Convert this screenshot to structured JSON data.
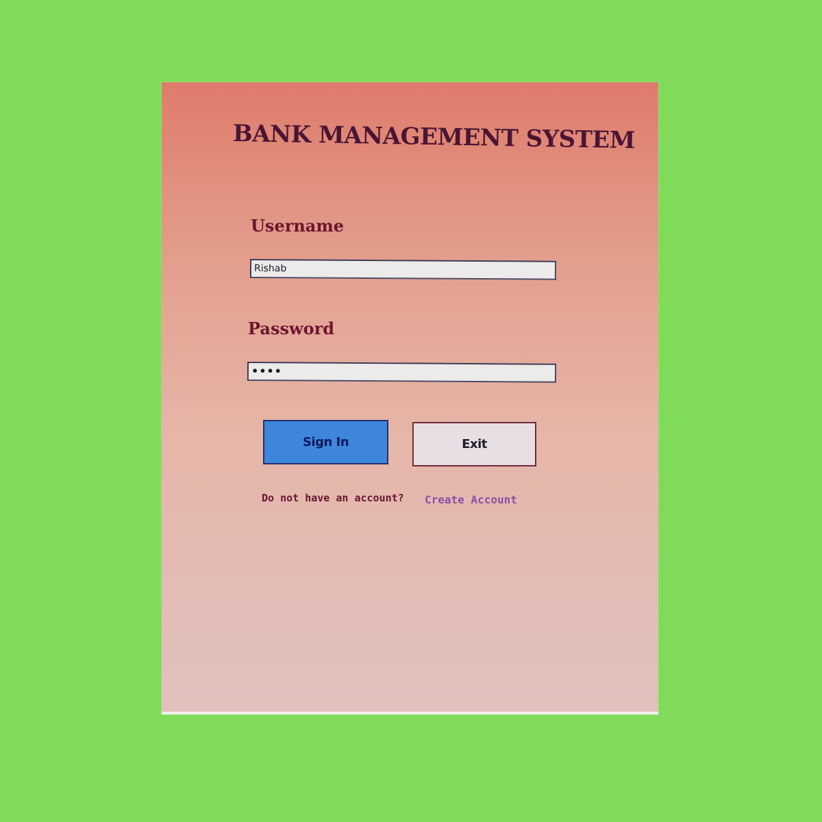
{
  "app": {
    "title": "BANK MANAGEMENT SYSTEM"
  },
  "login_form": {
    "username_label": "Username",
    "username_value": "Rishab",
    "password_label": "Password",
    "password_value": "••••",
    "signin_label": "Sign In",
    "exit_label": "Exit",
    "account_prompt": "Do not have an account?",
    "create_account_link": "Create Account"
  },
  "colors": {
    "background": "#80DB5A",
    "panel_top": "#df7c6c",
    "panel_bottom": "#e2c0bd",
    "title_text": "#4a1533",
    "label_text": "#6e1430",
    "signin_button": "#3d86dc",
    "exit_button": "#e8dfe4",
    "link_text": "#8a4fa8"
  }
}
